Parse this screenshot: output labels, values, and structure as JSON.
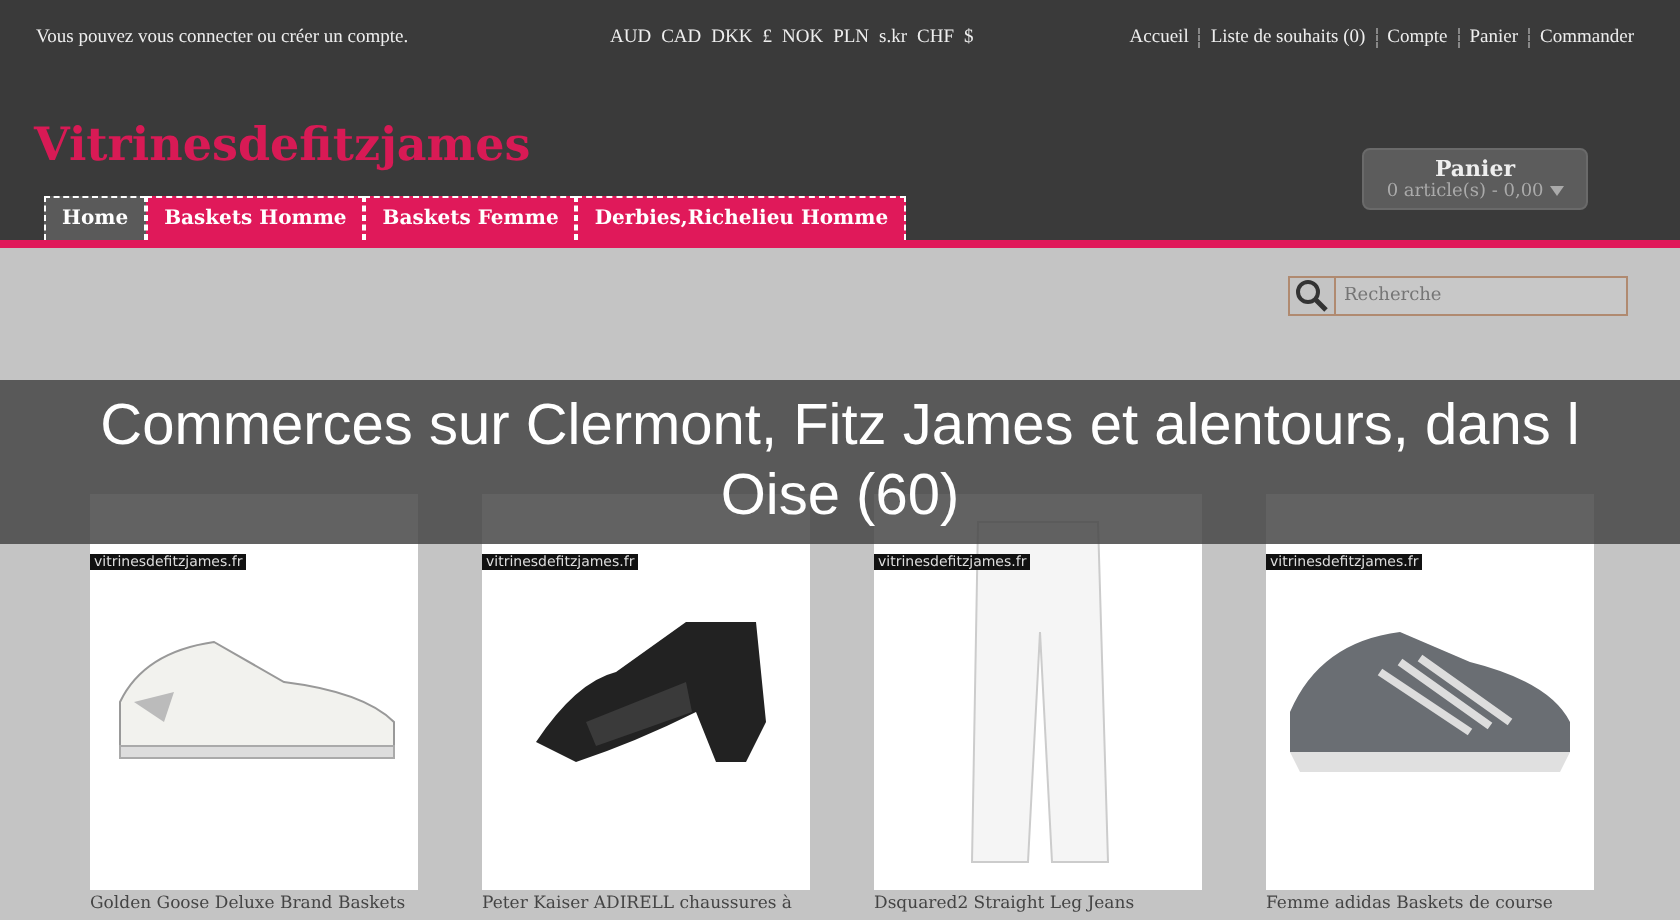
{
  "top_bar": {
    "login_text": "Vous pouvez vous connecter ou créer un compte.",
    "currencies": [
      "AUD",
      "CAD",
      "DKK",
      "£",
      "NOK",
      "PLN",
      "s.kr",
      "CHF",
      "$"
    ],
    "links": [
      "Accueil",
      "Liste de souhaits (0)",
      "Compte",
      "Panier",
      "Commander"
    ]
  },
  "header": {
    "logo": "Vitrinesdefitzjames",
    "cart": {
      "title": "Panier",
      "summary": "0 article(s) - 0,00"
    }
  },
  "nav": [
    {
      "label": "Home",
      "selected": true
    },
    {
      "label": "Baskets Homme",
      "selected": false
    },
    {
      "label": "Baskets Femme",
      "selected": false
    },
    {
      "label": "Derbies,Richelieu Homme",
      "selected": false
    }
  ],
  "search": {
    "placeholder": "Recherche"
  },
  "overlay_title": "Commerces sur Clermont, Fitz James et alentours, dans l Oise (60)",
  "products": [
    {
      "tag": "vitrinesdefitzjames.fr",
      "kind": "sneaker",
      "name": "Golden Goose Deluxe Brand Baskets"
    },
    {
      "tag": "vitrinesdefitzjames.fr",
      "kind": "shoe",
      "name": "Peter Kaiser ADIRELL chaussures à"
    },
    {
      "tag": "vitrinesdefitzjames.fr",
      "kind": "jeans",
      "name": "Dsquared2 Straight Leg Jeans"
    },
    {
      "tag": "vitrinesdefitzjames.fr",
      "kind": "runner",
      "name": "Femme adidas Baskets de course"
    }
  ]
}
